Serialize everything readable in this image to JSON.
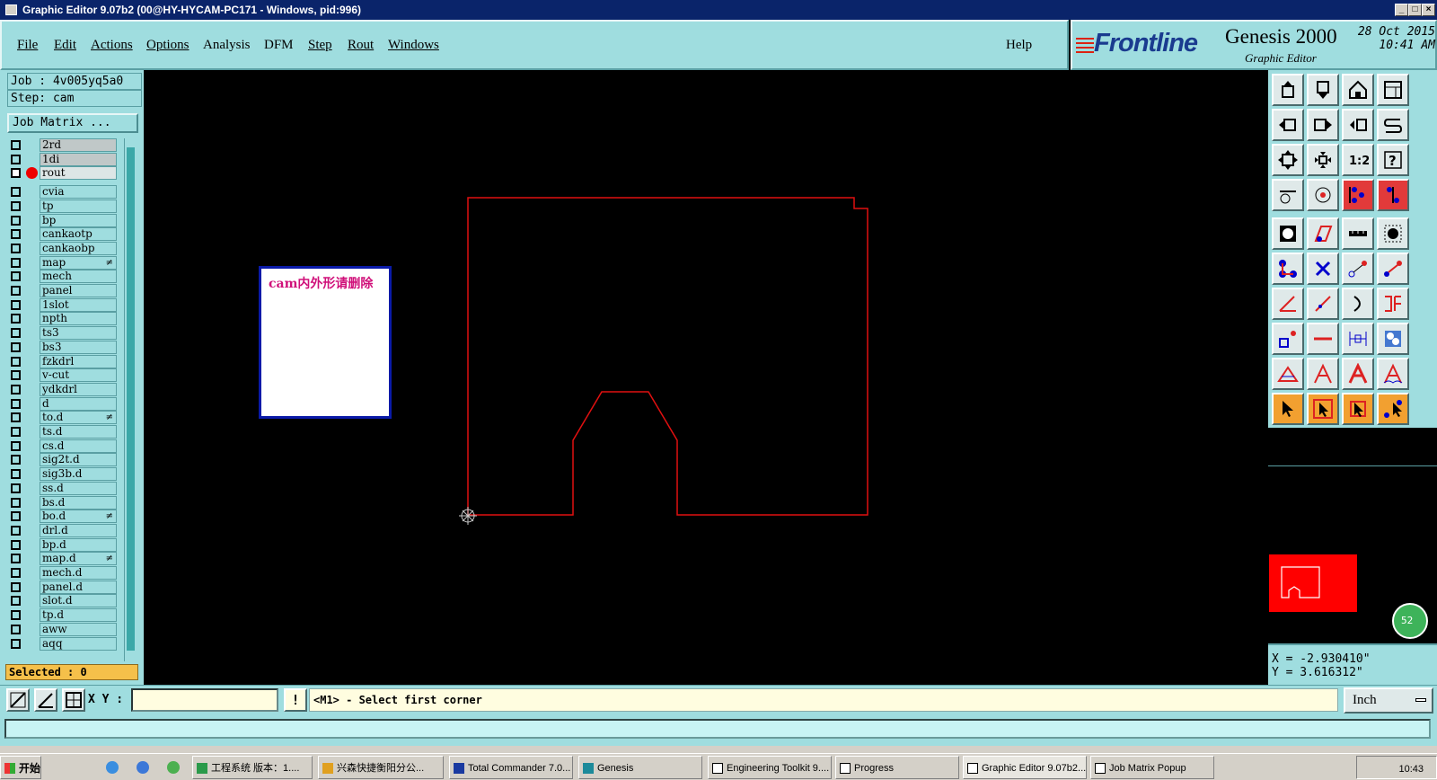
{
  "window": {
    "title": "Graphic Editor 9.07b2 (00@HY-HYCAM-PC171 - Windows, pid:996)",
    "minimize": "_",
    "maximize": "□",
    "close": "×"
  },
  "menu": {
    "items": [
      "File",
      "Edit",
      "Actions",
      "Options",
      "Analysis",
      "DFM",
      "Step",
      "Rout",
      "Windows"
    ],
    "help": "Help"
  },
  "brand": {
    "logo": "Frontline",
    "product": "Genesis 2000",
    "subtitle": "Graphic Editor",
    "date": "28 Oct 2015",
    "time": "10:41 AM"
  },
  "job": {
    "job_line": "Job : 4v005yq5a0",
    "step_line": "Step: cam",
    "matrix_button": "Job Matrix ...",
    "selected": "Selected : 0"
  },
  "layers": [
    {
      "name": "2rd",
      "state": "grey"
    },
    {
      "name": "1di",
      "state": "grey"
    },
    {
      "name": "rout",
      "state": "active"
    },
    {
      "name": "cvia"
    },
    {
      "name": "tp"
    },
    {
      "name": "bp"
    },
    {
      "name": "cankaotp"
    },
    {
      "name": "cankaobp"
    },
    {
      "name": "map",
      "mark": "≠"
    },
    {
      "name": "mech"
    },
    {
      "name": "panel"
    },
    {
      "name": "1slot"
    },
    {
      "name": "npth"
    },
    {
      "name": "ts3"
    },
    {
      "name": "bs3"
    },
    {
      "name": "fzkdrl"
    },
    {
      "name": "v-cut"
    },
    {
      "name": "ydkdrl"
    },
    {
      "name": "d"
    },
    {
      "name": "to.d",
      "mark": "≠"
    },
    {
      "name": "ts.d"
    },
    {
      "name": "cs.d"
    },
    {
      "name": "sig2t.d"
    },
    {
      "name": "sig3b.d"
    },
    {
      "name": "ss.d"
    },
    {
      "name": "bs.d"
    },
    {
      "name": "bo.d",
      "mark": "≠"
    },
    {
      "name": "drl.d"
    },
    {
      "name": "bp.d"
    },
    {
      "name": "map.d",
      "mark": "≠"
    },
    {
      "name": "mech.d"
    },
    {
      "name": "panel.d"
    },
    {
      "name": "slot.d"
    },
    {
      "name": "tp.d"
    },
    {
      "name": "aww"
    },
    {
      "name": "aqq"
    }
  ],
  "canvas": {
    "note_text": "cam内外形请删除"
  },
  "coords": {
    "x": "X = -2.930410\"",
    "y": "Y =  3.616312\""
  },
  "overview": {
    "badge": "52"
  },
  "command": {
    "xy_label": "X Y :",
    "xy_value": "",
    "excl": "!",
    "message": "<M1> - Select first corner",
    "units": "Inch"
  },
  "taskbar": {
    "start": "开始",
    "items": [
      "工程系统  版本：1....",
      "兴森快捷衡阳分公...",
      "Total Commander 7.0...",
      "Genesis",
      "Engineering Toolkit 9....",
      "Progress",
      "Graphic Editor 9.07b2...",
      "Job Matrix Popup"
    ],
    "clock": "10:43"
  },
  "colors": {
    "panel": "#9fdddf",
    "outline": "#e01010",
    "note_border": "#0a1aa8",
    "note_text": "#d0107a"
  }
}
